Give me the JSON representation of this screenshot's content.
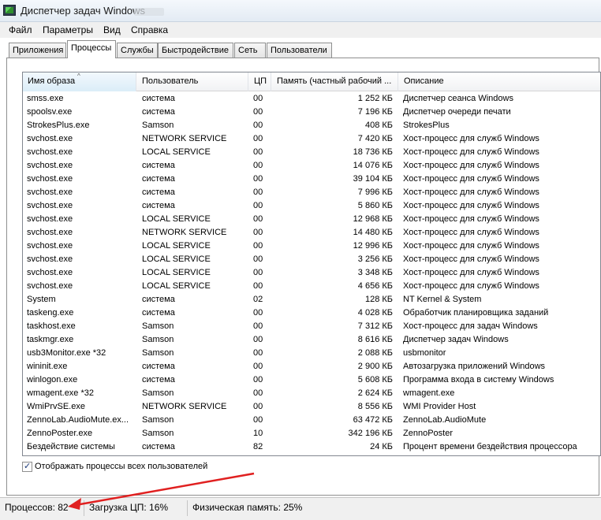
{
  "window": {
    "title": "Диспетчер задач Windows",
    "icon": "task-manager-icon"
  },
  "menu": [
    "Файл",
    "Параметры",
    "Вид",
    "Справка"
  ],
  "tabs": [
    "Приложения",
    "Процессы",
    "Службы",
    "Быстродействие",
    "Сеть",
    "Пользователи"
  ],
  "active_tab": "Процессы",
  "columns": [
    "Имя образа",
    "Пользователь",
    "ЦП",
    "Память (частный рабочий ...",
    "Описание"
  ],
  "sort": {
    "column": "Имя образа",
    "direction": "ascending",
    "icon": "sort-asc-icon"
  },
  "rows": [
    [
      "smss.exe",
      "система",
      "00",
      "1 252 КБ",
      "Диспетчер сеанса  Windows"
    ],
    [
      "spoolsv.exe",
      "система",
      "00",
      "7 196 КБ",
      "Диспетчер очереди печати"
    ],
    [
      "StrokesPlus.exe",
      "Samson",
      "00",
      "408 КБ",
      "StrokesPlus"
    ],
    [
      "svchost.exe",
      "NETWORK SERVICE",
      "00",
      "7 420 КБ",
      "Хост-процесс для служб Windows"
    ],
    [
      "svchost.exe",
      "LOCAL SERVICE",
      "00",
      "18 736 КБ",
      "Хост-процесс для служб Windows"
    ],
    [
      "svchost.exe",
      "система",
      "00",
      "14 076 КБ",
      "Хост-процесс для служб Windows"
    ],
    [
      "svchost.exe",
      "система",
      "00",
      "39 104 КБ",
      "Хост-процесс для служб Windows"
    ],
    [
      "svchost.exe",
      "система",
      "00",
      "7 996 КБ",
      "Хост-процесс для служб Windows"
    ],
    [
      "svchost.exe",
      "система",
      "00",
      "5 860 КБ",
      "Хост-процесс для служб Windows"
    ],
    [
      "svchost.exe",
      "LOCAL SERVICE",
      "00",
      "12 968 КБ",
      "Хост-процесс для служб Windows"
    ],
    [
      "svchost.exe",
      "NETWORK SERVICE",
      "00",
      "14 480 КБ",
      "Хост-процесс для служб Windows"
    ],
    [
      "svchost.exe",
      "LOCAL SERVICE",
      "00",
      "12 996 КБ",
      "Хост-процесс для служб Windows"
    ],
    [
      "svchost.exe",
      "LOCAL SERVICE",
      "00",
      "3 256 КБ",
      "Хост-процесс для служб Windows"
    ],
    [
      "svchost.exe",
      "LOCAL SERVICE",
      "00",
      "3 348 КБ",
      "Хост-процесс для служб Windows"
    ],
    [
      "svchost.exe",
      "LOCAL SERVICE",
      "00",
      "4 656 КБ",
      "Хост-процесс для служб Windows"
    ],
    [
      "System",
      "система",
      "02",
      "128 КБ",
      "NT Kernel & System"
    ],
    [
      "taskeng.exe",
      "система",
      "00",
      "4 028 КБ",
      "Обработчик планировщика заданий"
    ],
    [
      "taskhost.exe",
      "Samson",
      "00",
      "7 312 КБ",
      "Хост-процесс для задач Windows"
    ],
    [
      "taskmgr.exe",
      "Samson",
      "00",
      "8 616 КБ",
      "Диспетчер задач Windows"
    ],
    [
      "usb3Monitor.exe *32",
      "Samson",
      "00",
      "2 088 КБ",
      "usbmonitor"
    ],
    [
      "wininit.exe",
      "система",
      "00",
      "2 900 КБ",
      "Автозагрузка приложений Windows"
    ],
    [
      "winlogon.exe",
      "система",
      "00",
      "5 608 КБ",
      "Программа входа в систему Windows"
    ],
    [
      "wmagent.exe *32",
      "Samson",
      "00",
      "2 624 КБ",
      "wmagent.exe"
    ],
    [
      "WmiPrvSE.exe",
      "NETWORK SERVICE",
      "00",
      "8 556 КБ",
      "WMI Provider Host"
    ],
    [
      "ZennoLab.AudioMute.ex...",
      "Samson",
      "00",
      "63 472 КБ",
      "ZennoLab.AudioMute"
    ],
    [
      "ZennoPoster.exe",
      "Samson",
      "10",
      "342 196 КБ",
      "ZennoPoster"
    ],
    [
      "Бездействие системы",
      "система",
      "82",
      "24 КБ",
      "Процент времени бездействия процессора"
    ]
  ],
  "show_all_users": {
    "label": "Отображать процессы всех пользователей",
    "checked": true
  },
  "status": {
    "processes": "Процессов: 82",
    "cpu": "Загрузка ЦП: 16%",
    "memory": "Физическая память: 25%"
  },
  "annotation_color": "#e02020"
}
